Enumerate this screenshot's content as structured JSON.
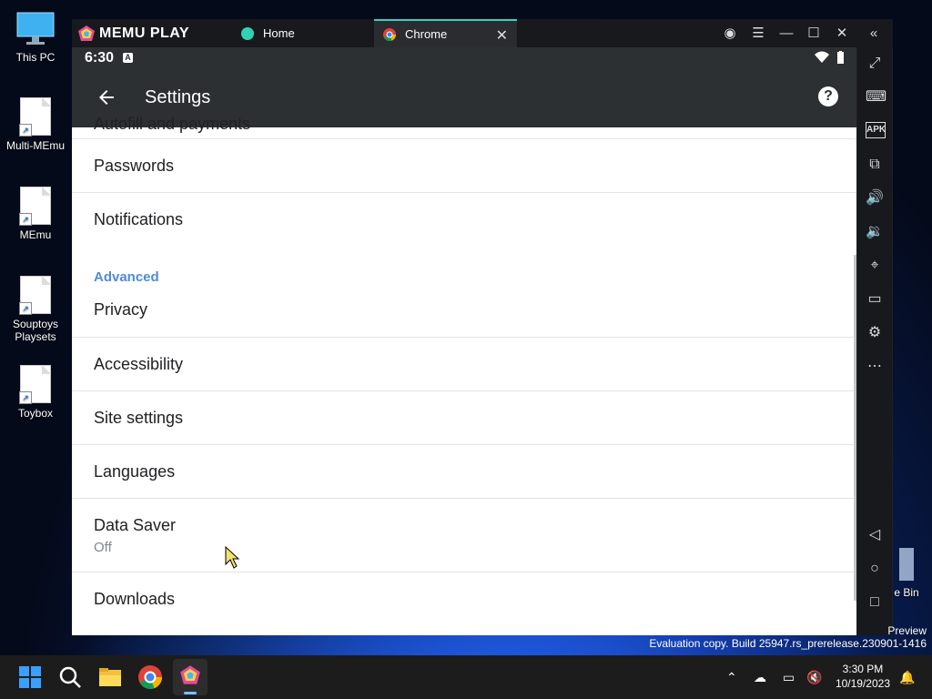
{
  "desktop": {
    "icons": [
      {
        "label": "This PC"
      },
      {
        "label": "Multi-MEmu"
      },
      {
        "label": "MEmu"
      },
      {
        "label": "Souptoys Playsets"
      },
      {
        "label": "Toybox"
      }
    ],
    "recycle_bin_label": "e Bin",
    "preview_label": "Preview",
    "watermark": "Evaluation copy. Build 25947.rs_prerelease.230901-1416"
  },
  "emulator": {
    "brand": "MEMU PLAY",
    "tabs": [
      {
        "label": "Home",
        "active": false
      },
      {
        "label": "Chrome",
        "active": true
      }
    ],
    "accent_color": "#34d3c0"
  },
  "android": {
    "status_time": "6:30",
    "status_badge": "A",
    "appbar_title": "Settings",
    "partial_row": "Autofill and payments",
    "rows_top": [
      {
        "label": "Passwords"
      },
      {
        "label": "Notifications"
      }
    ],
    "section_header": "Advanced",
    "rows_advanced": [
      {
        "label": "Privacy"
      },
      {
        "label": "Accessibility"
      },
      {
        "label": "Site settings"
      },
      {
        "label": "Languages"
      }
    ],
    "data_saver": {
      "label": "Data Saver",
      "value": "Off"
    },
    "last_row": "Downloads"
  },
  "taskbar": {
    "time": "3:30 PM",
    "date": "10/19/2023"
  }
}
